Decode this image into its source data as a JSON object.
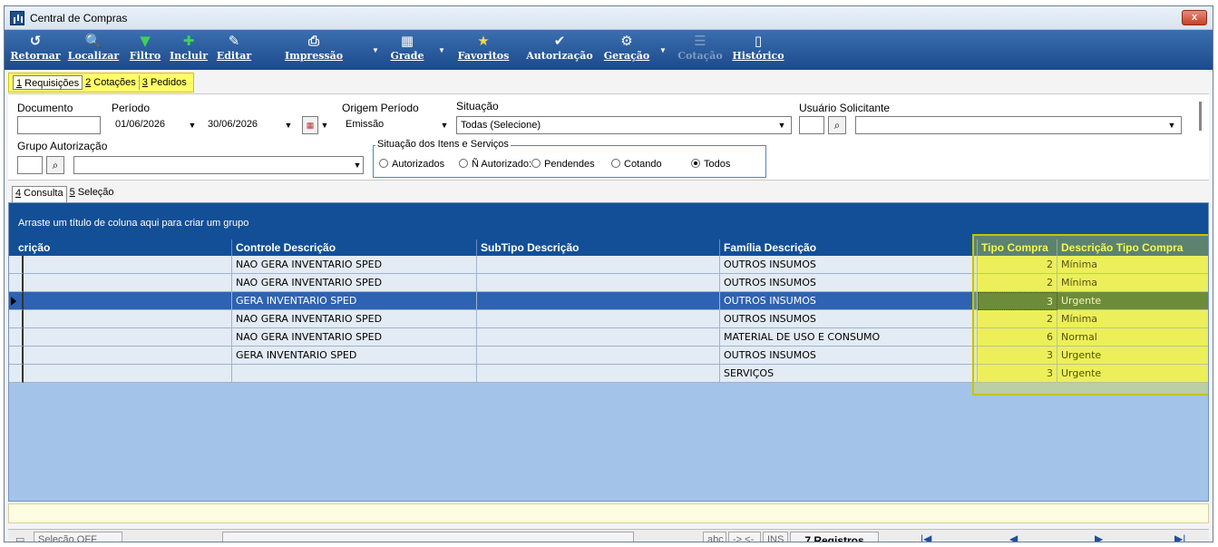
{
  "window": {
    "title": "Central de Compras",
    "close_label": "x"
  },
  "toolbar": {
    "buttons": [
      {
        "label": "Retornar",
        "icon": "↺"
      },
      {
        "label": "Localizar",
        "icon": "🔍"
      },
      {
        "label": "Filtro",
        "icon": "▼"
      },
      {
        "label": "Incluir",
        "icon": "✚"
      },
      {
        "label": "Editar",
        "icon": "✎"
      },
      {
        "label": "Impressão",
        "icon": "⎙"
      },
      {
        "label": "Grade",
        "icon": "▦"
      },
      {
        "label": "Favoritos",
        "icon": "★"
      },
      {
        "label": "Autorização",
        "icon": "✔"
      },
      {
        "label": "Geração",
        "icon": "⚙"
      },
      {
        "label": "Cotação",
        "icon": "☰"
      },
      {
        "label": "Histórico",
        "icon": "▯"
      }
    ]
  },
  "top_tabs": [
    {
      "num": "1",
      "label": " Requisições"
    },
    {
      "num": "2",
      "label": " Cotações"
    },
    {
      "num": "3",
      "label": " Pedidos"
    }
  ],
  "filters": {
    "documento_label": "Documento",
    "documento_value": "",
    "periodo_label": "Período",
    "periodo_start": "01/06/2026",
    "periodo_end": "30/06/2026",
    "origem_label": "Origem Período",
    "origem_value": "Emissão",
    "situacao_label": "Situação",
    "situacao_value": "Todas (Selecione)",
    "usuario_label": "Usuário Solicitante",
    "grupo_label": "Grupo Autorização",
    "itens_label": "Situação dos Itens e Serviços",
    "radios": [
      "Autorizados",
      "Ñ Autorizado:",
      "Pendendes",
      "Cotando",
      "Todos"
    ],
    "radio_selected": "Todos"
  },
  "sub_tabs": [
    {
      "num": "4",
      "label": " Consulta"
    },
    {
      "num": "5",
      "label": " Seleção"
    }
  ],
  "grid": {
    "group_hint": "Arraste um título de coluna aqui para criar um grupo",
    "columns": [
      "crição",
      "Controle Descrição",
      "SubTipo Descrição",
      "Família Descrição",
      "Tipo Compra",
      "Descrição Tipo Compra"
    ],
    "rows": [
      {
        "descr": "",
        "controle": "NAO GERA INVENTARIO SPED",
        "subtipo": "",
        "familia": "OUTROS INSUMOS",
        "tipo": "2",
        "desc_tipo": "Mínima"
      },
      {
        "descr": "",
        "controle": "NAO GERA INVENTARIO SPED",
        "subtipo": "",
        "familia": "OUTROS INSUMOS",
        "tipo": "2",
        "desc_tipo": "Mínima"
      },
      {
        "descr": "",
        "controle": "GERA INVENTARIO SPED",
        "subtipo": "",
        "familia": "OUTROS INSUMOS",
        "tipo": "3",
        "desc_tipo": "Urgente"
      },
      {
        "descr": "",
        "controle": "NAO GERA INVENTARIO SPED",
        "subtipo": "",
        "familia": "OUTROS INSUMOS",
        "tipo": "2",
        "desc_tipo": "Mínima"
      },
      {
        "descr": "",
        "controle": "NAO GERA INVENTARIO SPED",
        "subtipo": "",
        "familia": "MATERIAL DE USO E CONSUMO",
        "tipo": "6",
        "desc_tipo": "Normal"
      },
      {
        "descr": "",
        "controle": "GERA INVENTARIO SPED",
        "subtipo": "",
        "familia": "OUTROS INSUMOS",
        "tipo": "3",
        "desc_tipo": "Urgente"
      },
      {
        "descr": "",
        "controle": "",
        "subtipo": "",
        "familia": "SERVIÇOS",
        "tipo": "3",
        "desc_tipo": "Urgente"
      }
    ],
    "selected_row": 2
  },
  "status": {
    "selecao": "Seleção OFF",
    "abc": "abc",
    "arrows": "-> <-",
    "ins": "INS",
    "registros": "7 Registros",
    "nav_first": "|◀",
    "nav_prev": "◀",
    "nav_next": "▶",
    "nav_last": "▶|"
  }
}
